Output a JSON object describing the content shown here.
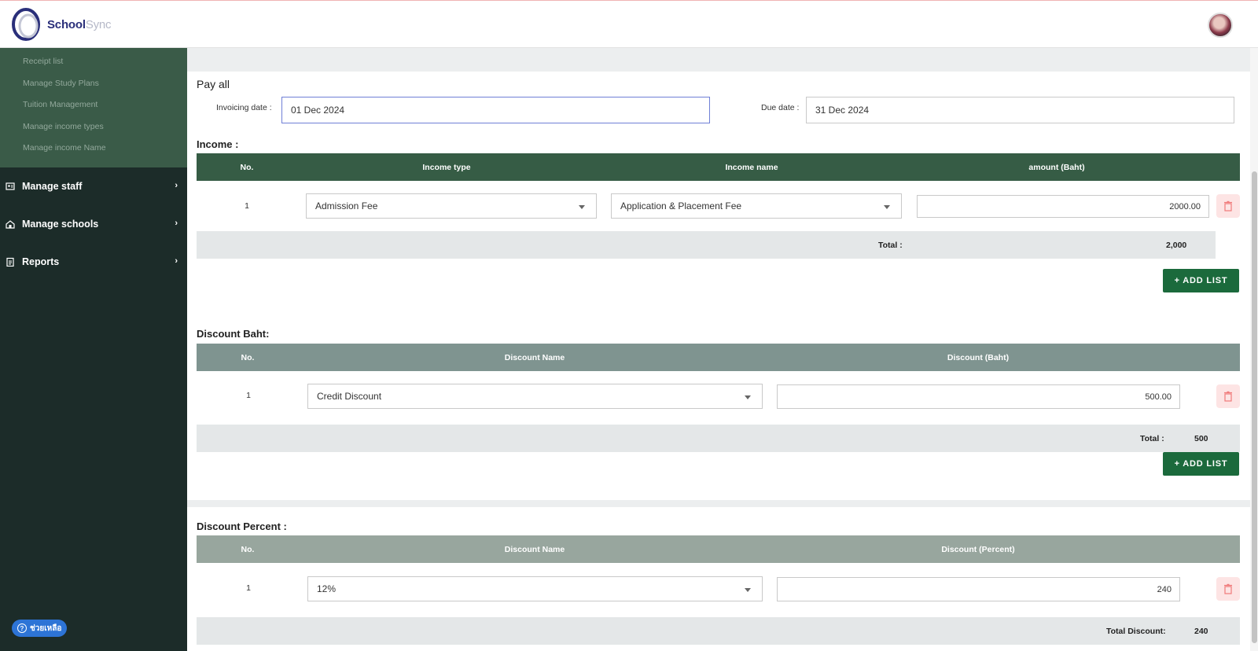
{
  "app": {
    "brand_a": "School",
    "brand_b": "Sync"
  },
  "sidebar": {
    "submenu": [
      "Receipt list",
      "Manage Study Plans",
      "Tuition Management",
      "Manage income types",
      "Manage income Name"
    ],
    "menu": [
      {
        "label": "Manage staff",
        "icon": "staff-icon"
      },
      {
        "label": "Manage schools",
        "icon": "school-icon"
      },
      {
        "label": "Reports",
        "icon": "clipboard-icon"
      }
    ],
    "help_label": "ช่วยเหลือ"
  },
  "form": {
    "title": "Pay all",
    "invoicing_label": "Invoicing date :",
    "invoicing_value": "01 Dec 2024",
    "due_label": "Due date :",
    "due_value": "31 Dec 2024"
  },
  "income": {
    "title": "Income :",
    "headers": {
      "no": "No.",
      "type": "Income type",
      "name": "Income name",
      "amount": "amount (Baht)"
    },
    "rows": [
      {
        "no": "1",
        "type": "Admission Fee",
        "name": "Application & Placement Fee",
        "amount": "2000.00"
      }
    ],
    "total_label": "Total :",
    "total_value": "2,000",
    "add_label": "+ ADD LIST"
  },
  "discount_baht": {
    "title": "Discount Baht:",
    "headers": {
      "no": "No.",
      "name": "Discount Name",
      "amount": "Discount (Baht)"
    },
    "rows": [
      {
        "no": "1",
        "name": "Credit Discount",
        "amount": "500.00"
      }
    ],
    "total_label": "Total :",
    "total_value": "500",
    "add_label": "+ ADD LIST"
  },
  "discount_percent": {
    "title": "Discount Percent :",
    "headers": {
      "no": "No.",
      "name": "Discount Name",
      "amount": "Discount (Percent)"
    },
    "rows": [
      {
        "no": "1",
        "name": "12%",
        "amount": "240"
      }
    ],
    "total_label": "Total Discount:",
    "total_value": "240"
  },
  "colors": {
    "sidebar_bg": "#1c2c29",
    "submenu_bg": "#3a5b48",
    "accent_green": "#1b6a3c",
    "help_blue": "#2d74d6"
  }
}
